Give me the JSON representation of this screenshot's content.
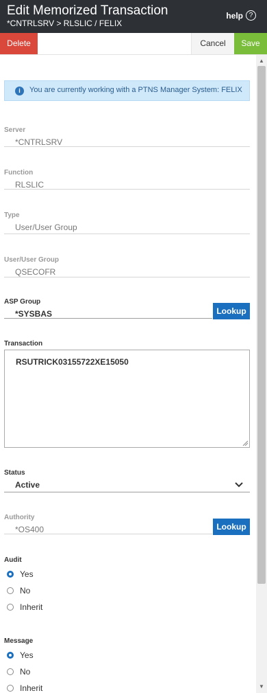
{
  "header": {
    "title": "Edit Memorized Transaction",
    "breadcrumb": "*CNTRLSRV > RLSLIC / FELIX",
    "help_label": "help",
    "help_icon_glyph": "?"
  },
  "toolbar": {
    "delete_label": "Delete",
    "cancel_label": "Cancel",
    "save_label": "Save",
    "delete_color": "#d9483b",
    "save_color": "#79bd3a"
  },
  "info": {
    "message": "You are currently working with a PTNS Manager System: FELIX",
    "icon_glyph": "i"
  },
  "form": {
    "server": {
      "label": "Server",
      "value": "*CNTRLSRV"
    },
    "function": {
      "label": "Function",
      "value": "RLSLIC"
    },
    "type": {
      "label": "Type",
      "value": "User/User Group"
    },
    "user_group": {
      "label": "User/User Group",
      "value": "QSECOFR"
    },
    "asp_group": {
      "label": "ASP Group",
      "value": "*SYSBAS",
      "lookup_label": "Lookup"
    },
    "transaction": {
      "label": "Transaction",
      "value": "RSUTRICK03155722XE15050"
    },
    "status": {
      "label": "Status",
      "value": "Active"
    },
    "authority": {
      "label": "Authority",
      "value": "*OS400",
      "lookup_label": "Lookup"
    },
    "audit": {
      "label": "Audit",
      "options": [
        "Yes",
        "No",
        "Inherit"
      ],
      "selected": "Yes"
    },
    "message": {
      "label": "Message",
      "options": [
        "Yes",
        "No",
        "Inherit"
      ],
      "selected": "Yes"
    }
  }
}
